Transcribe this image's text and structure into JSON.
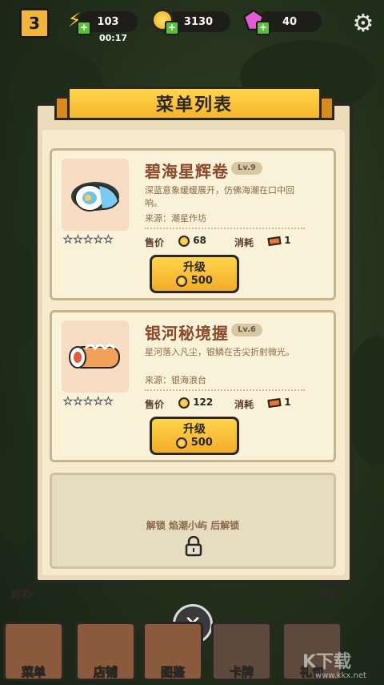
{
  "hud": {
    "level": "3",
    "energy": "103",
    "timer": "00:17",
    "coins": "3130",
    "gems": "40"
  },
  "modal": {
    "title": "菜单列表",
    "dishes": [
      {
        "name": "碧海星辉卷",
        "level": "Lv.9",
        "description": "深蓝意象缓缓展开，仿佛海潮在口中回响。",
        "source": "来源：潮星作坊",
        "price_label": "售价",
        "price": "68",
        "cost_label": "消耗",
        "cost": "1",
        "upgrade_label": "升级",
        "upgrade_cost": "500",
        "stars": "★★★★★"
      },
      {
        "name": "银河秘境握",
        "level": "Lv.6",
        "description": "星河落入凡尘，银鳞在舌尖折射微光。",
        "source": "来源：银海浪台",
        "price_label": "售价",
        "price": "122",
        "cost_label": "消耗",
        "cost": "1",
        "upgrade_label": "升级",
        "upgrade_cost": "500",
        "stars": "★★★★★"
      }
    ],
    "locked": {
      "text": "解锁 焰潮小屿 后解锁"
    }
  },
  "side_labels": {
    "left": "库存",
    "right": "山海"
  },
  "nav": [
    {
      "label": "菜单"
    },
    {
      "label": "店铺"
    },
    {
      "label": "图鉴"
    },
    {
      "label": "卡牌"
    },
    {
      "label": "礼包"
    }
  ],
  "watermark": {
    "main": "K下载",
    "sub": "www.kkx.net"
  },
  "colors": {
    "accent": "#f5b42a",
    "title_text": "#8a4a2a",
    "panel": "#f6eccd"
  }
}
